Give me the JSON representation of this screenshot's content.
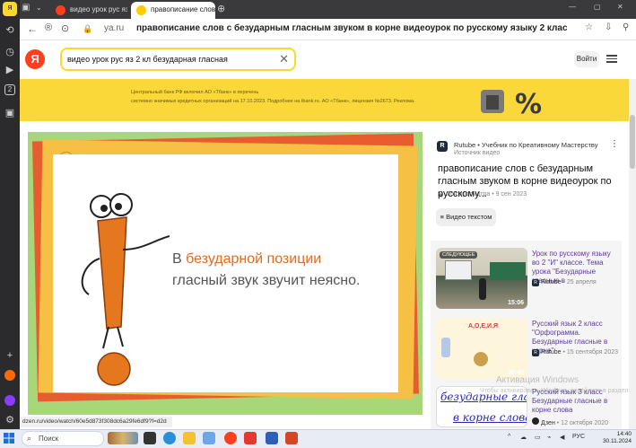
{
  "tabs": [
    {
      "label": "видео урок рус яз 2 кл б",
      "color": "#fc3f1d"
    },
    {
      "label": "правописание слов",
      "color": "#ffcc00",
      "active": true
    }
  ],
  "address": {
    "domain": "ya.ru",
    "title": "правописание слов с безударным гласным звуком в корне видеоурок по русскому языку 2 класс - смотреть онлайн в поиске Яндекса по..."
  },
  "header": {
    "logo": "Я",
    "search_value": "видео урок рус яз 2 кл безударная гласная",
    "login": "Войти"
  },
  "banner": {
    "line1": "Центральный банк РФ включил АО «Тбанк» в перечень",
    "line2": "системно значимых кредитных организаций на 17.10.2023. Подробнее на tbank.ru. АО «Тбанк», лицензия №2673. Реклома."
  },
  "video": {
    "text_prefix": "В ",
    "text_highlight": "безударной позиции",
    "line2": "гласный звук звучит неясно."
  },
  "source": {
    "channel": "Rutube • Учебник по Креативному Мастерству",
    "label": "Источник видео",
    "title": "правописание слов с безударным гласным звуком в корне видеоурок по русскому...",
    "meta": "264 просмотра • 9 сен 2023",
    "text_button": "Видео текстом"
  },
  "related": [
    {
      "badge": "СЛЕДУЮЩЕЕ",
      "title": "Урок по русскому языку во 2 \"И\" классе. Тема урока \"Безударные гласные в",
      "source": "Rutube",
      "date": "25 апреля",
      "duration": "15:06"
    },
    {
      "title": "Русский язык 2 класс \"Орфограмма. Безударные гласные в корне\"",
      "source": "Rutube",
      "date": "15 сентября 2023",
      "duration": "15:40",
      "thumb_text": "А,О,Е,И,Я"
    },
    {
      "title": "Русский язык 3 класс Безударные гласные в корне слова",
      "source": "Дзен",
      "date": "12 октября 2020",
      "thumb_line1": "безударные гласные",
      "thumb_line2": "в корне слова"
    }
  ],
  "status_url": "dzen.ru/video/watch/60e5d873f308dc6a29fe6df9?f=d2d",
  "watermark": {
    "line1": "Активация Windows",
    "line2": "Чтобы активировать Windows, перейдите в раздел"
  },
  "taskbar": {
    "search": "Поиск",
    "lang": "РУС",
    "time": "14:40",
    "date": "30.11.2024"
  }
}
